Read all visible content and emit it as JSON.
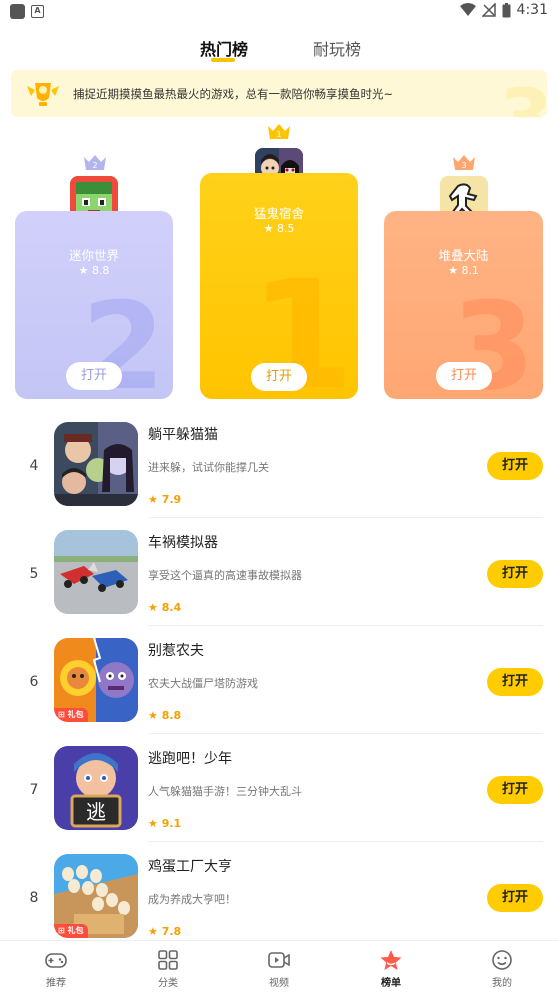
{
  "status_bar": {
    "time": "4:31"
  },
  "tabs": [
    {
      "label": "热门榜",
      "active": true
    },
    {
      "label": "耐玩榜",
      "active": false
    }
  ],
  "banner": {
    "text": "捕捉近期摸摸鱼最热最火的游戏，总有一款陪你畅享摸鱼时光~"
  },
  "podium": [
    {
      "rank": "1",
      "name": "猛鬼宿舍",
      "rating": "8.5",
      "open_label": "打开",
      "color": "#ffc400"
    },
    {
      "rank": "2",
      "name": "迷你世界",
      "rating": "8.8",
      "open_label": "打开",
      "color": "#c8c9f8"
    },
    {
      "rank": "3",
      "name": "堆叠大陆",
      "rating": "8.1",
      "open_label": "打开",
      "color": "#ffab78"
    }
  ],
  "list": [
    {
      "rank": "4",
      "title": "躺平躲猫猫",
      "desc": "进来躲，试试你能撑几关",
      "score": "7.9",
      "open_label": "打开",
      "gift": ""
    },
    {
      "rank": "5",
      "title": "车祸模拟器",
      "desc": "享受这个逼真的高速事故模拟器",
      "score": "8.4",
      "open_label": "打开",
      "gift": ""
    },
    {
      "rank": "6",
      "title": "别惹农夫",
      "desc": "农夫大战僵尸塔防游戏",
      "score": "8.8",
      "open_label": "打开",
      "gift": "礼包"
    },
    {
      "rank": "7",
      "title": "逃跑吧！少年",
      "desc": "人气躲猫猫手游！三分钟大乱斗",
      "score": "9.1",
      "open_label": "打开",
      "gift": ""
    },
    {
      "rank": "8",
      "title": "鸡蛋工厂大亨",
      "desc": "成为养成大亨吧！",
      "score": "7.8",
      "open_label": "打开",
      "gift": "礼包"
    }
  ],
  "icon_text": {
    "escape_badge": "逃"
  },
  "bottom_nav": [
    {
      "label": "推荐",
      "icon": "gamepad-icon",
      "active": false
    },
    {
      "label": "分类",
      "icon": "grid-icon",
      "active": false
    },
    {
      "label": "视频",
      "icon": "video-icon",
      "active": false
    },
    {
      "label": "榜单",
      "icon": "star-icon",
      "active": true
    },
    {
      "label": "我的",
      "icon": "smiley-icon",
      "active": false
    }
  ],
  "colors": {
    "accent": "#ffcc00",
    "score": "#f5a000"
  }
}
